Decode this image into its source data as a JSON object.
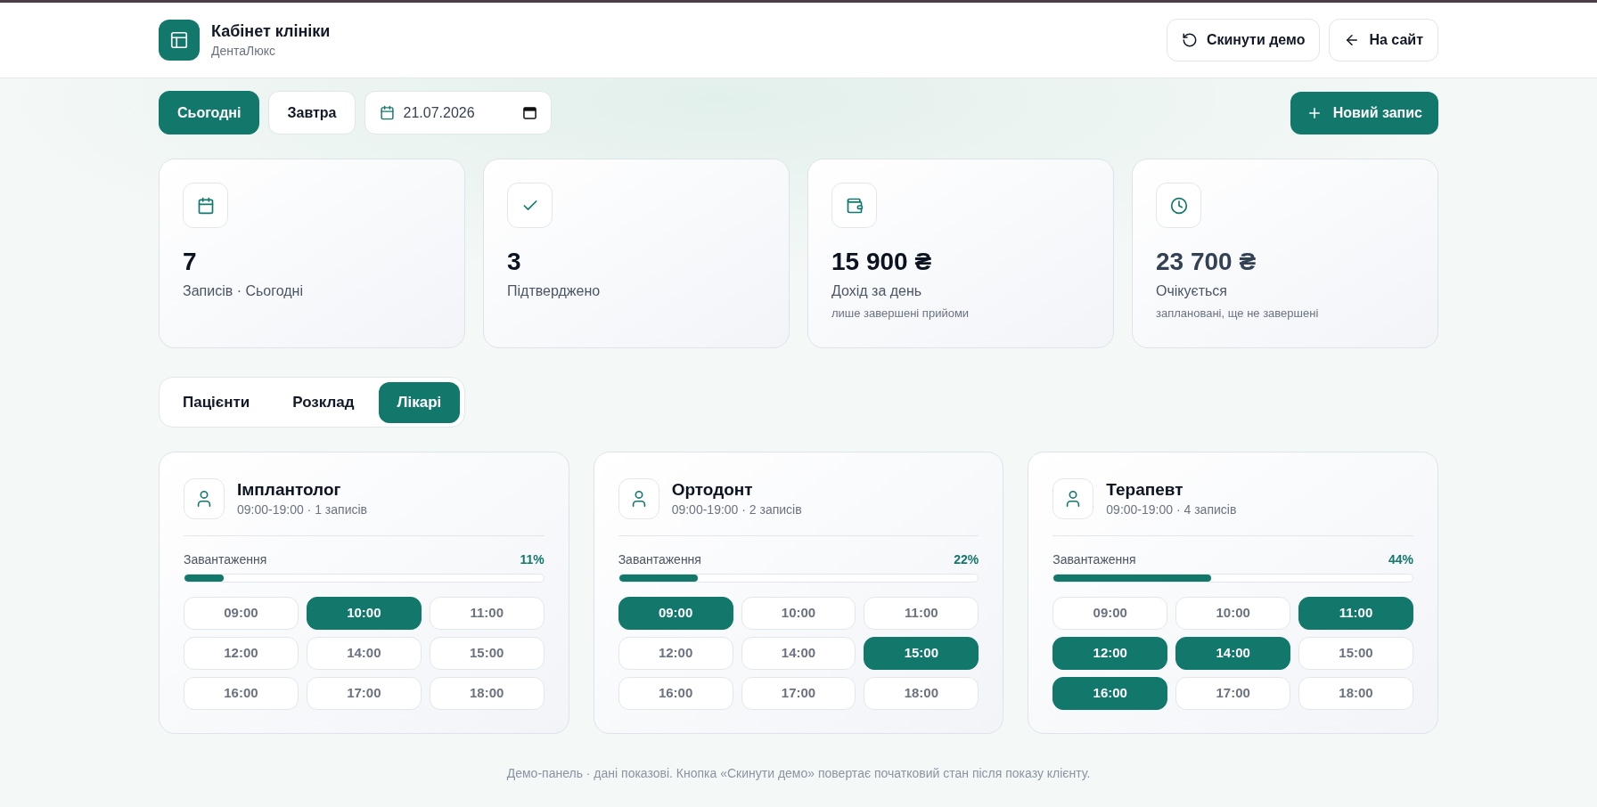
{
  "header": {
    "title": "Кабінет клініки",
    "subtitle": "ДентаЛюкс",
    "actions": [
      {
        "kind": "reset",
        "label": "Скинути демо"
      },
      {
        "kind": "back",
        "label": "На сайт"
      }
    ]
  },
  "toolbar": {
    "days": [
      {
        "label": "Сьогодні",
        "selected": true
      },
      {
        "label": "Завтра",
        "selected": false
      }
    ],
    "date": {
      "value": "21.07.2026"
    },
    "new_button": {
      "label": "Новий запис"
    }
  },
  "stats": [
    {
      "kind": "appointments",
      "value": "7",
      "label": "Записів · Сьогодні",
      "muted": false
    },
    {
      "kind": "confirmed",
      "value": "3",
      "label": "Підтверджено",
      "muted": false
    },
    {
      "kind": "revenue",
      "value": "15 900 ₴",
      "label": "Дохід за день",
      "note": "лише завершені прийоми",
      "muted": false
    },
    {
      "kind": "pending",
      "value": "23 700 ₴",
      "label": "Очікується",
      "note": "заплановані, ще не завершені",
      "muted": true
    }
  ],
  "tabs": [
    {
      "label": "Пацієнти",
      "selected": false
    },
    {
      "label": "Розклад",
      "selected": false
    },
    {
      "label": "Лікарі",
      "selected": true
    }
  ],
  "doctors": [
    {
      "name": "Імплантолог",
      "schedule": "09:00-19:00 · 1 записів",
      "load_label": "Завантаження",
      "level": 0.11,
      "reading": "11%",
      "slots": [
        {
          "time": "09:00",
          "booked": false
        },
        {
          "time": "10:00",
          "booked": true
        },
        {
          "time": "11:00",
          "booked": false
        },
        {
          "time": "12:00",
          "booked": false
        },
        {
          "time": "14:00",
          "booked": false
        },
        {
          "time": "15:00",
          "booked": false
        },
        {
          "time": "16:00",
          "booked": false
        },
        {
          "time": "17:00",
          "booked": false
        },
        {
          "time": "18:00",
          "booked": false
        }
      ]
    },
    {
      "name": "Ортодонт",
      "schedule": "09:00-19:00 · 2 записів",
      "load_label": "Завантаження",
      "level": 0.22,
      "reading": "22%",
      "slots": [
        {
          "time": "09:00",
          "booked": true
        },
        {
          "time": "10:00",
          "booked": false
        },
        {
          "time": "11:00",
          "booked": false
        },
        {
          "time": "12:00",
          "booked": false
        },
        {
          "time": "14:00",
          "booked": false
        },
        {
          "time": "15:00",
          "booked": true
        },
        {
          "time": "16:00",
          "booked": false
        },
        {
          "time": "17:00",
          "booked": false
        },
        {
          "time": "18:00",
          "booked": false
        }
      ]
    },
    {
      "name": "Терапевт",
      "schedule": "09:00-19:00 · 4 записів",
      "load_label": "Завантаження",
      "level": 0.44,
      "reading": "44%",
      "slots": [
        {
          "time": "09:00",
          "booked": false
        },
        {
          "time": "10:00",
          "booked": false
        },
        {
          "time": "11:00",
          "booked": true
        },
        {
          "time": "12:00",
          "booked": true
        },
        {
          "time": "14:00",
          "booked": true
        },
        {
          "time": "15:00",
          "booked": false
        },
        {
          "time": "16:00",
          "booked": true
        },
        {
          "time": "17:00",
          "booked": false
        },
        {
          "time": "18:00",
          "booked": false
        }
      ]
    }
  ],
  "footer": {
    "text": "Демо-панель · дані показові. Кнопка «Скинути демо» повертає початковий стан після показу клієнту."
  }
}
